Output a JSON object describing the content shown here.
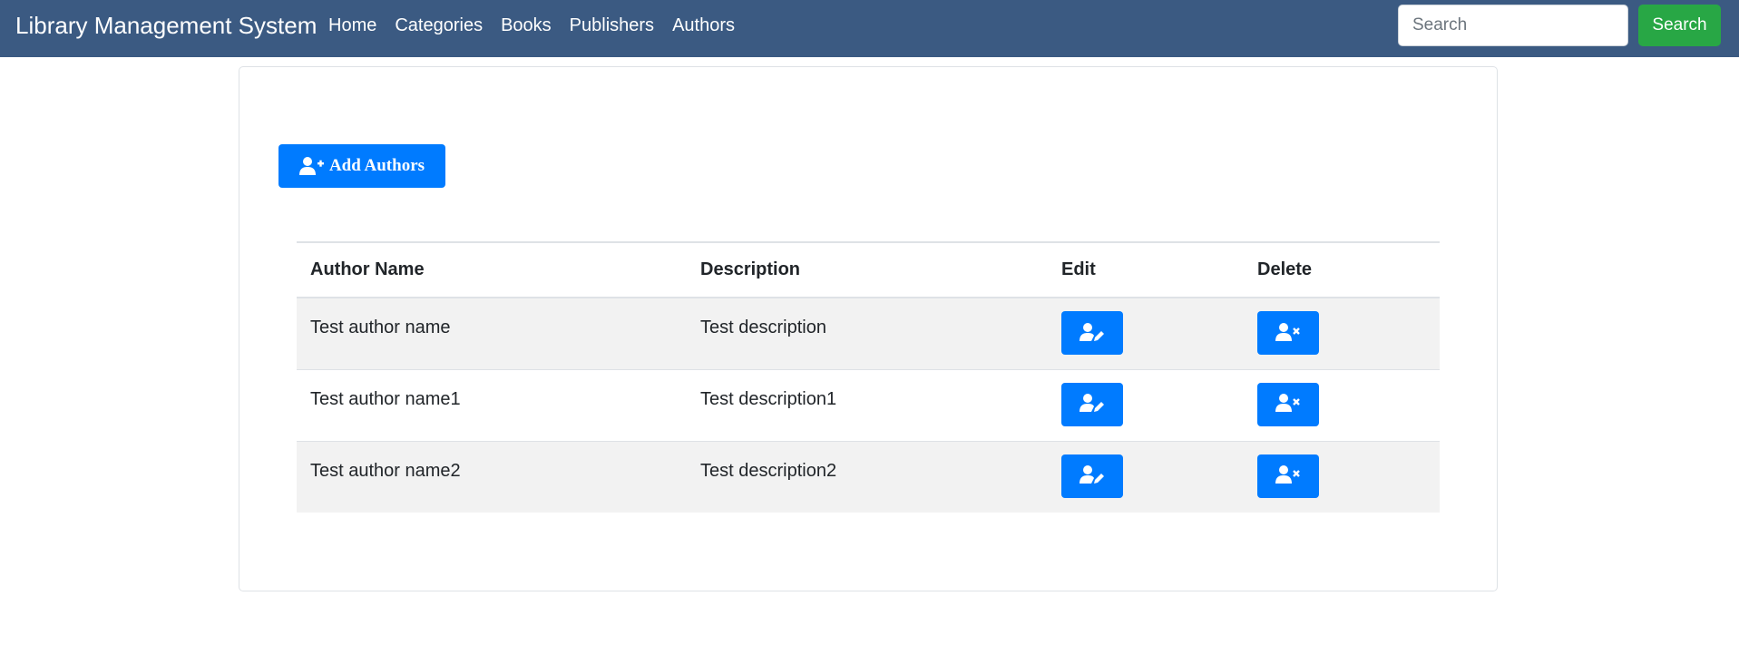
{
  "navbar": {
    "brand": "Library Management System",
    "links": [
      "Home",
      "Categories",
      "Books",
      "Publishers",
      "Authors"
    ],
    "search_placeholder": "Search",
    "search_button": "Search"
  },
  "toolbar": {
    "add_label": "Add Authors",
    "add_icon": "user-plus-icon"
  },
  "table": {
    "headers": [
      "Author Name",
      "Description",
      "Edit",
      "Delete"
    ],
    "rows": [
      {
        "name": "Test author name",
        "description": "Test description"
      },
      {
        "name": "Test author name1",
        "description": "Test description1"
      },
      {
        "name": "Test author name2",
        "description": "Test description2"
      }
    ],
    "edit_icon": "user-edit-icon",
    "delete_icon": "user-remove-icon"
  },
  "colors": {
    "navbar": "#3b5a82",
    "primary": "#007bff",
    "success": "#28a745",
    "stripe": "#f2f2f2"
  }
}
